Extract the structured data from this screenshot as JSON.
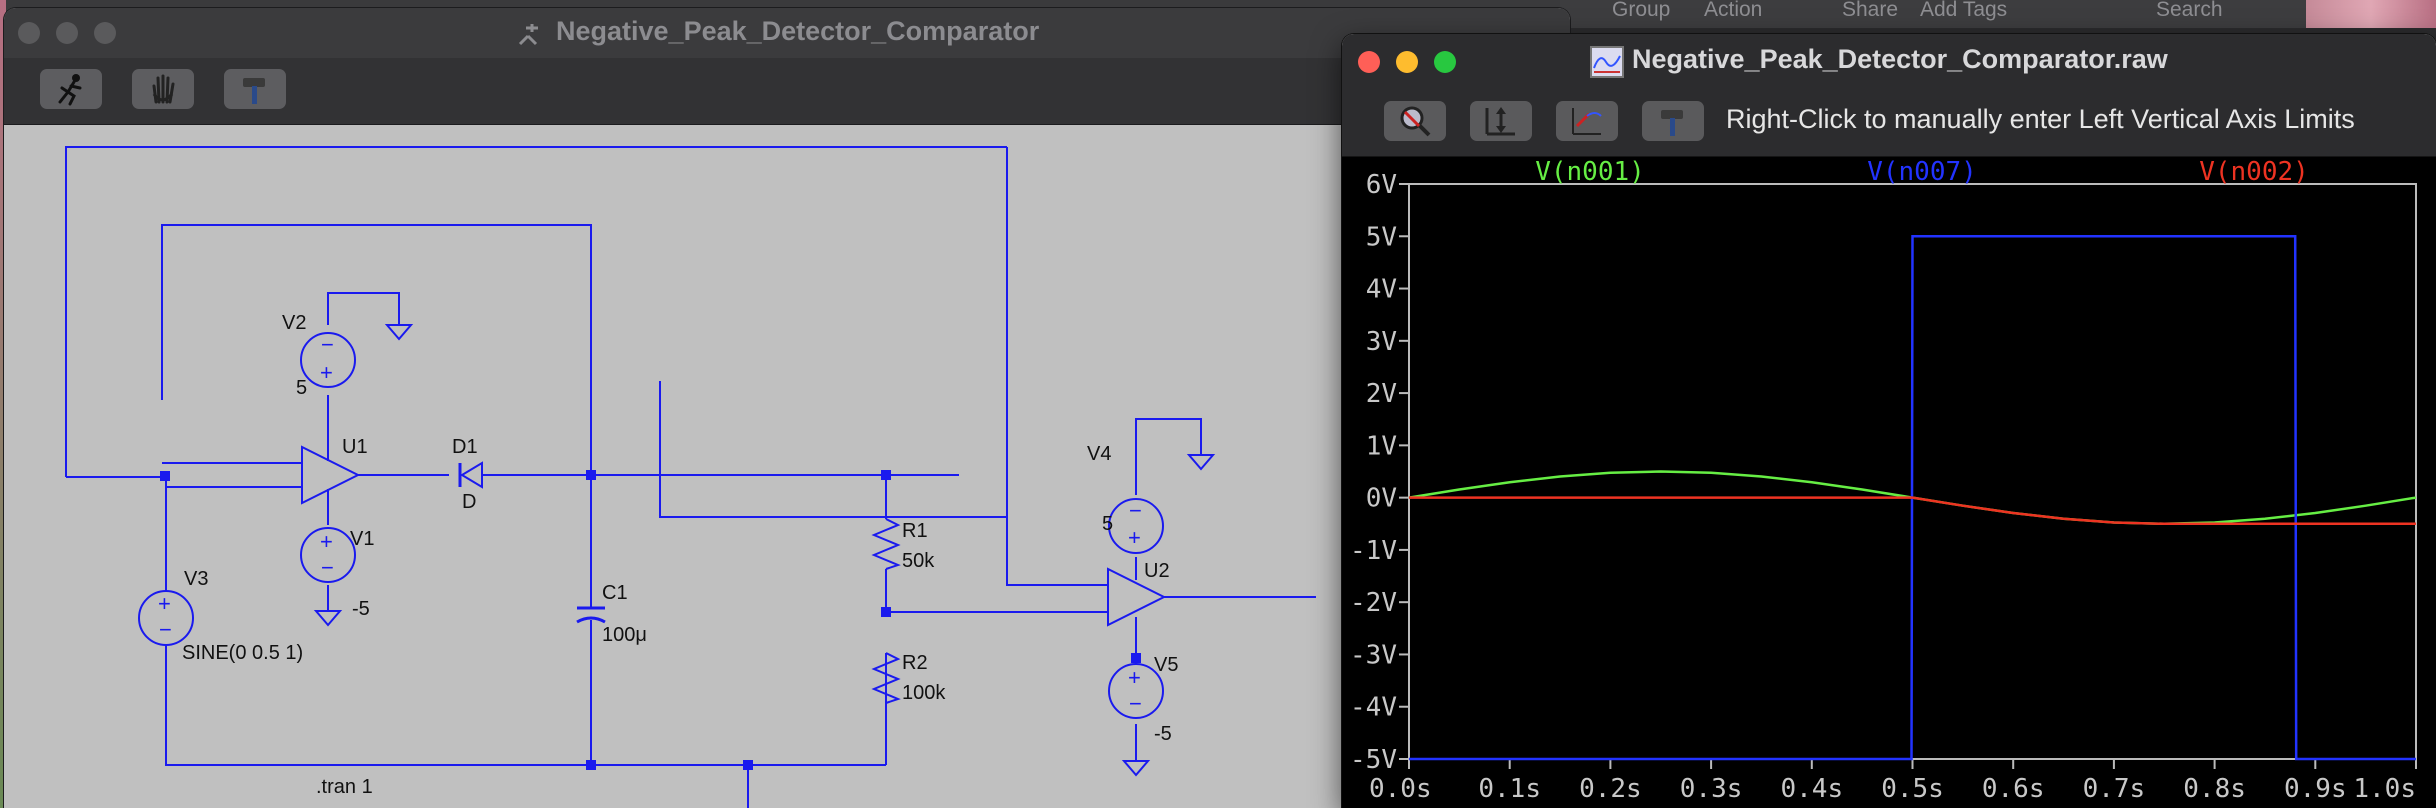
{
  "background_app": {
    "menu": [
      "Group",
      "Action",
      "Share",
      "Add Tags",
      "Search"
    ]
  },
  "schematic_window": {
    "title": "Negative_Peak_Detector_Comparator",
    "toolbar": {
      "run_icon": "running-man-icon",
      "halt_icon": "hand-icon",
      "settings_icon": "hammer-icon"
    },
    "components": {
      "V2": {
        "name": "V2",
        "value": "5"
      },
      "V1": {
        "name": "V1",
        "value": "-5"
      },
      "V3": {
        "name": "V3",
        "value": "SINE(0 0.5 1)"
      },
      "U1": {
        "name": "U1"
      },
      "D1": {
        "name": "D1",
        "value": "D"
      },
      "C1": {
        "name": "C1",
        "value": "100μ"
      },
      "R1": {
        "name": "R1",
        "value": "50k"
      },
      "R2": {
        "name": "R2",
        "value": "100k"
      },
      "V4": {
        "name": "V4",
        "value": "5"
      },
      "V5": {
        "name": "V5",
        "value": "-5"
      },
      "U2": {
        "name": "U2"
      }
    },
    "directive": ".tran 1"
  },
  "plot_window": {
    "title": "Negative_Peak_Detector_Comparator.raw",
    "hint": "Right-Click to manually enter Left Vertical Axis Limits",
    "toolbar_icons": [
      "zoom-full-icon",
      "autorange-icon",
      "pan-back-icon",
      "hammer-icon"
    ]
  },
  "chart_data": {
    "type": "line",
    "title": "",
    "xlabel": "",
    "ylabel": "",
    "xlim": [
      0.0,
      1.0
    ],
    "ylim": [
      -5,
      6
    ],
    "xticks": [
      "0.0s",
      "0.1s",
      "0.2s",
      "0.3s",
      "0.4s",
      "0.5s",
      "0.6s",
      "0.7s",
      "0.8s",
      "0.9s",
      "1.0s"
    ],
    "xtick_values": [
      0,
      0.1,
      0.2,
      0.3,
      0.4,
      0.5,
      0.6,
      0.7,
      0.8,
      0.9,
      1.0
    ],
    "yticks": [
      "6V",
      "5V",
      "4V",
      "3V",
      "2V",
      "1V",
      "0V",
      "-1V",
      "-2V",
      "-3V",
      "-4V",
      "-5V"
    ],
    "ytick_values": [
      6,
      5,
      4,
      3,
      2,
      1,
      0,
      -1,
      -2,
      -3,
      -4,
      -5
    ],
    "background": "#000000",
    "series": [
      {
        "name": "V(n001)",
        "color": "#66ee44",
        "x": [
          0,
          0.05,
          0.1,
          0.15,
          0.2,
          0.25,
          0.3,
          0.35,
          0.4,
          0.45,
          0.5,
          0.55,
          0.6,
          0.65,
          0.7,
          0.75,
          0.8,
          0.85,
          0.9,
          0.95,
          1.0
        ],
        "y": [
          0,
          0.155,
          0.294,
          0.405,
          0.476,
          0.5,
          0.476,
          0.405,
          0.294,
          0.155,
          0,
          -0.155,
          -0.294,
          -0.405,
          -0.476,
          -0.5,
          -0.476,
          -0.405,
          -0.294,
          -0.155,
          0
        ]
      },
      {
        "name": "V(n007)",
        "color": "#2233ff",
        "x": [
          0,
          0.499,
          0.5,
          0.88,
          0.881,
          1.0
        ],
        "y": [
          -5,
          -5,
          5,
          5,
          -5,
          -5
        ]
      },
      {
        "name": "V(n002)",
        "color": "#ee3322",
        "x": [
          0,
          0.5,
          0.55,
          0.6,
          0.65,
          0.7,
          0.75,
          0.8,
          0.85,
          0.9,
          0.95,
          1.0
        ],
        "y": [
          0,
          0,
          -0.155,
          -0.294,
          -0.405,
          -0.476,
          -0.5,
          -0.5,
          -0.5,
          -0.5,
          -0.5,
          -0.5
        ]
      }
    ]
  }
}
